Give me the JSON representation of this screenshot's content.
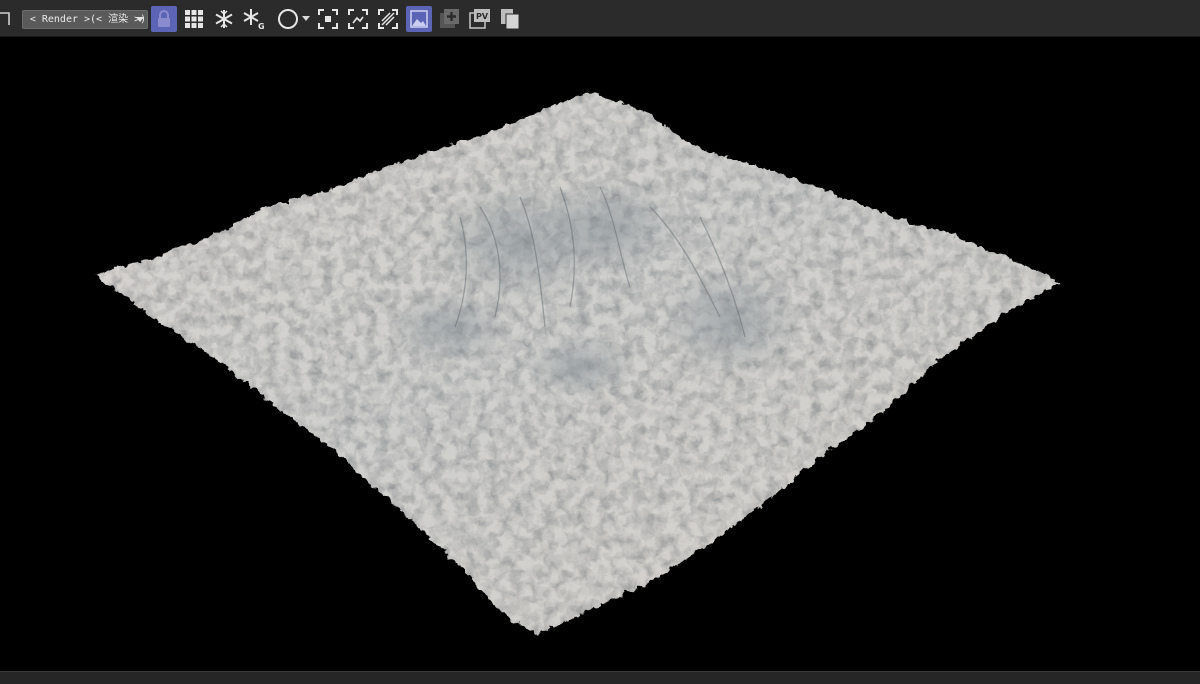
{
  "toolbar": {
    "render_dropdown": {
      "selected": "< Render >(< 渲染 >)"
    },
    "icons": [
      "lock-icon",
      "grid-icon",
      "freeze-icon",
      "freeze-global-icon",
      "circle-icon",
      "region-focus-icon",
      "expand-icon",
      "striped-icon",
      "image-icon",
      "add-layer-icon",
      "pv-icon",
      "copy-icon"
    ],
    "pv_label": "PV"
  },
  "viewport": {
    "subject": "snow terrain render"
  },
  "colors": {
    "toolbar_bg": "#2b2b2b",
    "accent": "#5b64b5",
    "viewport_bg": "#000000"
  }
}
